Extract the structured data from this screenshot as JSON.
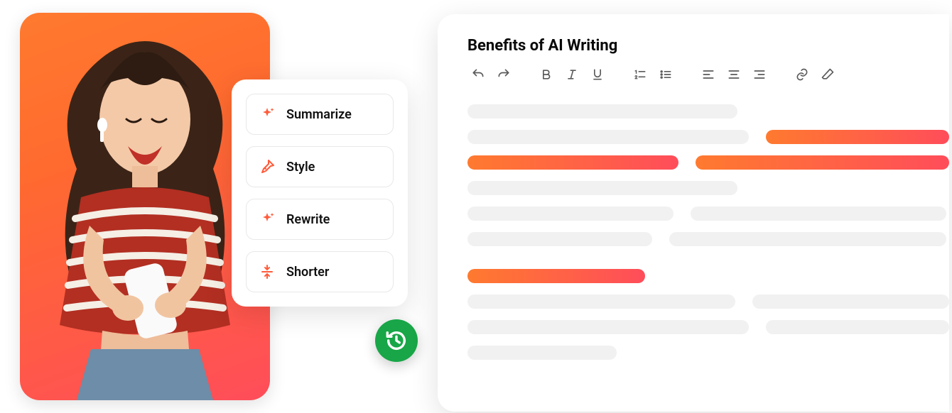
{
  "ai_panel": {
    "items": [
      {
        "label": "Summarize",
        "icon": "sparkle-icon"
      },
      {
        "label": "Style",
        "icon": "pen-nib-icon"
      },
      {
        "label": "Rewrite",
        "icon": "sparkle-icon"
      },
      {
        "label": "Shorter",
        "icon": "collapse-icon"
      }
    ]
  },
  "editor": {
    "title": "Benefits of AI Writing",
    "toolbar": [
      "undo-icon",
      "redo-icon",
      "gap",
      "bold-icon",
      "italic-icon",
      "underline-icon",
      "gap",
      "ordered-list-icon",
      "unordered-list-icon",
      "gap",
      "align-left-icon",
      "align-center-icon",
      "align-right-icon",
      "gap",
      "link-icon",
      "erase-icon"
    ]
  },
  "colors": {
    "accent_gradient_start": "#ff7a2f",
    "accent_gradient_end": "#ff4d5a",
    "badge_green": "#18a648",
    "placeholder_grey": "#f1f1f1"
  }
}
